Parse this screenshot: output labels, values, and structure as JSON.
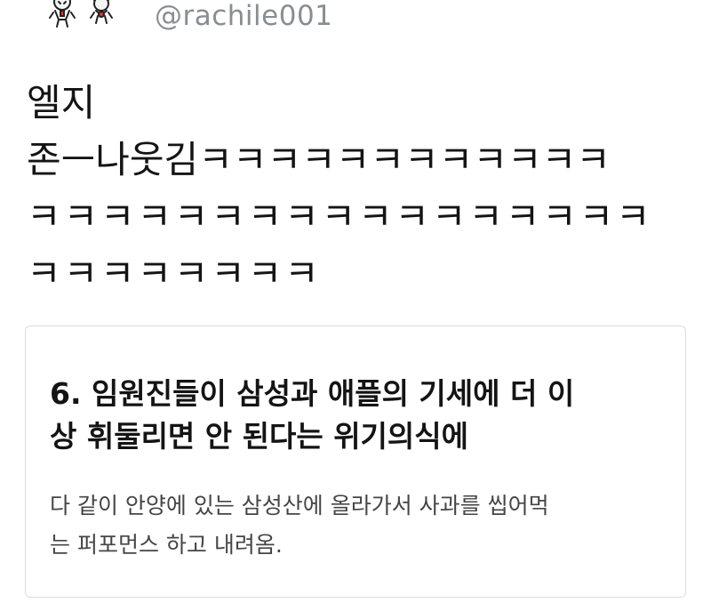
{
  "header": {
    "handle": "@rachile001"
  },
  "tweet": {
    "lines": [
      "엘지",
      "존ㅡ나웃김ㅋㅋㅋㅋㅋㅋㅋㅋㅋㅋㅋㅋ",
      "ㅋㅋㅋㅋㅋㅋㅋㅋㅋㅋㅋㅋㅋㅋㅋㅋㅋ",
      "ㅋㅋㅋㅋㅋㅋㅋㅋ"
    ]
  },
  "card": {
    "title_lines": [
      "6. 임원진들이 삼성과 애플의 기세에 더 이",
      "상 휘둘리면 안 된다는 위기의식에"
    ],
    "body_lines": [
      "다 같이 안양에 있는 삼성산에 올라가서 사과를 씹어먹",
      "는 퍼포먼스 하고 내려옴."
    ]
  },
  "icons": {
    "avatar": "cartoon-characters-avatar"
  }
}
